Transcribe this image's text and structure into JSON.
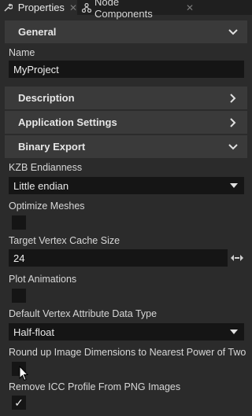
{
  "tabs": [
    {
      "label": "Properties",
      "close": "✕"
    },
    {
      "label": "Node Components",
      "close": "✕"
    }
  ],
  "sections": {
    "general": "General",
    "description": "Description",
    "application_settings": "Application Settings",
    "binary_export": "Binary Export"
  },
  "fields": {
    "name": {
      "label": "Name",
      "value": "MyProject"
    },
    "kzb_endianness": {
      "label": "KZB Endianness",
      "value": "Little endian"
    },
    "optimize_meshes": {
      "label": "Optimize Meshes",
      "checked": false
    },
    "target_vertex_cache_size": {
      "label": "Target Vertex Cache Size",
      "value": "24"
    },
    "plot_animations": {
      "label": "Plot Animations",
      "checked": false
    },
    "default_vertex_attribute_data_type": {
      "label": "Default Vertex Attribute Data Type",
      "value": "Half-float"
    },
    "round_up_image_dimensions": {
      "label": "Round up Image Dimensions to Nearest Power of Two",
      "checked": false
    },
    "remove_icc_profile": {
      "label": "Remove ICC Profile From PNG Images",
      "checked": true,
      "check_mark": "✓"
    }
  },
  "colors": {
    "background": "#2b2b2b",
    "section_header": "#3a3a3a",
    "field": "#151515",
    "text": "#e6e6e6"
  }
}
